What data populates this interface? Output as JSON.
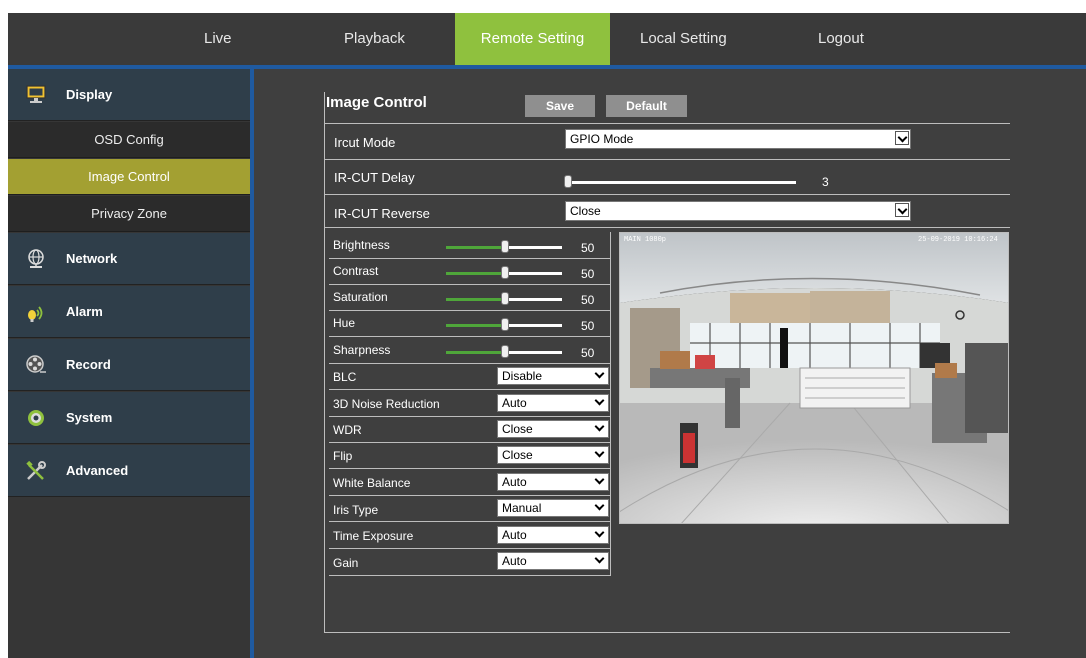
{
  "nav": {
    "items": [
      "Live",
      "Playback",
      "Remote Setting",
      "Local Setting",
      "Logout"
    ],
    "active": "Remote Setting"
  },
  "sidebar": {
    "groups": [
      {
        "label": "Display",
        "icon": "monitor-icon"
      },
      {
        "label": "Network",
        "icon": "globe-icon"
      },
      {
        "label": "Alarm",
        "icon": "siren-icon"
      },
      {
        "label": "Record",
        "icon": "film-reel-icon"
      },
      {
        "label": "System",
        "icon": "gear-icon"
      },
      {
        "label": "Advanced",
        "icon": "tools-icon"
      }
    ],
    "display_sub": [
      "OSD Config",
      "Image Control",
      "Privacy Zone"
    ],
    "active_sub": "Image Control"
  },
  "page": {
    "title": "Image Control",
    "save_label": "Save",
    "default_label": "Default"
  },
  "ircut": {
    "mode_label": "Ircut Mode",
    "mode_value": "GPIO Mode",
    "delay_label": "IR-CUT Delay",
    "delay_value": "3",
    "reverse_label": "IR-CUT Reverse",
    "reverse_value": "Close"
  },
  "sliders": [
    {
      "label": "Brightness",
      "value": "50"
    },
    {
      "label": "Contrast",
      "value": "50"
    },
    {
      "label": "Saturation",
      "value": "50"
    },
    {
      "label": "Hue",
      "value": "50"
    },
    {
      "label": "Sharpness",
      "value": "50"
    }
  ],
  "selects": [
    {
      "label": "BLC",
      "value": "Disable"
    },
    {
      "label": "3D Noise Reduction",
      "value": "Auto"
    },
    {
      "label": "WDR",
      "value": "Close"
    },
    {
      "label": "Flip",
      "value": "Close"
    },
    {
      "label": "White Balance",
      "value": "Auto"
    },
    {
      "label": "Iris Type",
      "value": "Manual"
    },
    {
      "label": "Time Exposure",
      "value": "Auto"
    },
    {
      "label": "Gain",
      "value": "Auto"
    }
  ],
  "preview": {
    "osd_left": "MAIN 1080p",
    "osd_right": "25-09-2019 10:16:24"
  },
  "colors": {
    "accent_nav": "#8fc13e",
    "accent_sub": "#a3a032",
    "divider_blue": "#1f5aa0",
    "slider_green": "#4fa63a"
  }
}
